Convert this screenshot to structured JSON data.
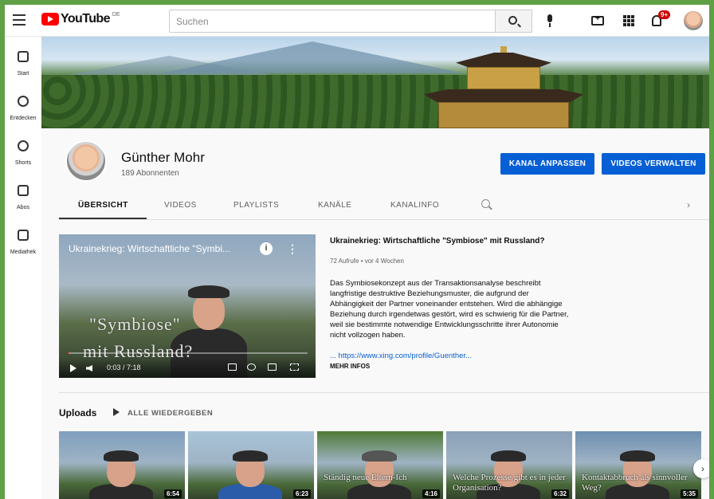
{
  "header": {
    "logo_text": "YouTube",
    "logo_country": "DE",
    "search_placeholder": "Suchen",
    "notification_count": "9+"
  },
  "sidebar": {
    "items": [
      {
        "label": "Start",
        "icon": "home-icon"
      },
      {
        "label": "Entdecken",
        "icon": "compass-icon"
      },
      {
        "label": "Shorts",
        "icon": "shorts-icon"
      },
      {
        "label": "Abos",
        "icon": "subscriptions-icon"
      },
      {
        "label": "Mediathek",
        "icon": "library-icon"
      }
    ]
  },
  "channel": {
    "name": "Günther Mohr",
    "subscribers": "189 Abonnenten",
    "buttons": {
      "customize": "KANAL ANPASSEN",
      "manage": "VIDEOS VERWALTEN"
    }
  },
  "tabs": [
    "ÜBERSICHT",
    "VIDEOS",
    "PLAYLISTS",
    "KANÄLE",
    "KANALINFO"
  ],
  "featured": {
    "player_title": "Ukrainekrieg: Wirtschaftliche \"Symbi...",
    "overlay_line1": "\"Symbiose\"",
    "overlay_line2": "mit Russland?",
    "time": "0:03 / 7:18",
    "progress": 0.007,
    "title": "Ukrainekrieg: Wirtschaftliche \"Symbiose\" mit Russland?",
    "meta": "72 Aufrufe • vor 4 Wochen",
    "description": "Das Symbiosekonzept aus der Transaktionsanalyse beschreibt langfristige destruktive Beziehungsmuster, die aufgrund der Abhängigkeit der Partner voneinander entstehen. Wird die abhängige Beziehung durch irgendetwas gestört, wird es schwierig für die Partner, weil sie bestimmte notwendige Entwicklungsschritte ihrer Autonomie nicht vollzogen haben.",
    "link": "... https://www.xing.com/profile/Guenther...",
    "more": "MEHR INFOS"
  },
  "uploads": {
    "title": "Uploads",
    "play_all": "ALLE WIEDERGEBEN",
    "videos": [
      {
        "overlay": "",
        "duration": "6:54",
        "bg": "#7f9fbf"
      },
      {
        "overlay": "",
        "duration": "6:23",
        "bg": "#a8c4d8"
      },
      {
        "overlay": "Ständig neue Eltern-Ich",
        "duration": "4:16",
        "bg": "#4f7a36"
      },
      {
        "overlay": "Welche Prozesse gibt es in jeder Organisation?",
        "duration": "6:32",
        "bg": "#8aa0b8"
      },
      {
        "overlay": "Kontaktabbruch als sinnvoller Weg?",
        "duration": "5:35",
        "bg": "#6d8fb0"
      }
    ]
  }
}
